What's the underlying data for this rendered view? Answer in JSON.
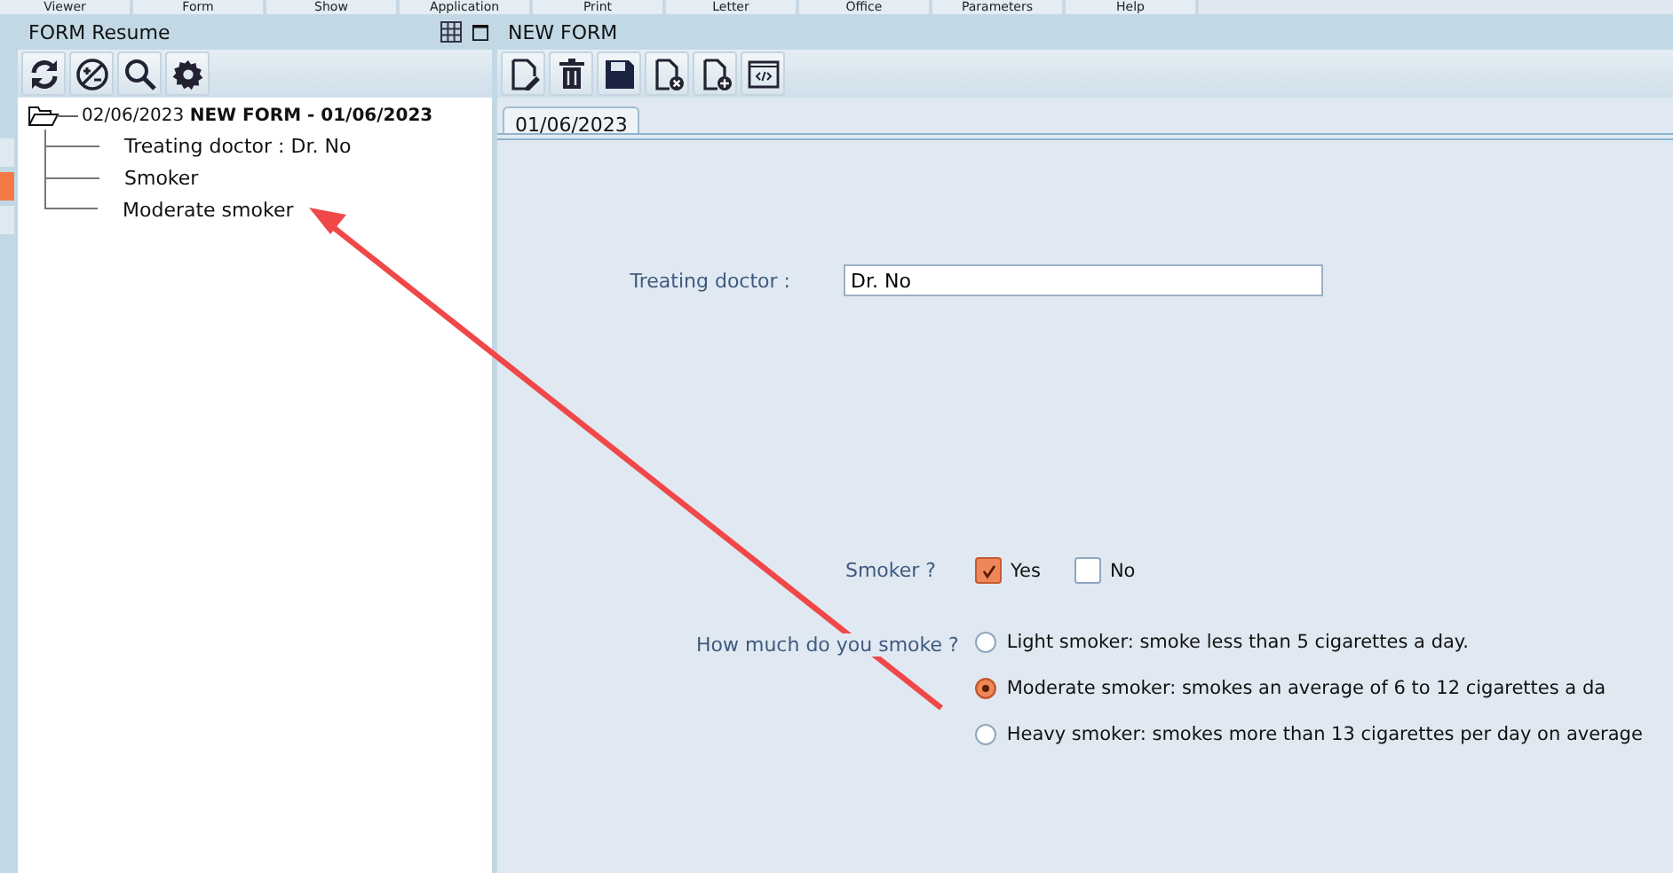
{
  "side_tabs": [
    {
      "selected": false
    },
    {
      "selected": true
    },
    {
      "selected": false
    }
  ],
  "menu": [
    "Viewer",
    "Form",
    "Show",
    "Application",
    "Print",
    "Letter",
    "Office",
    "Parameters",
    "Help"
  ],
  "left_panel": {
    "title": "FORM Resume",
    "tree": [
      {
        "date": "02/06/2023",
        "title": "NEW FORM - 01/06/2023",
        "expanded": true,
        "children": [
          {
            "label": "Treating doctor : Dr. No"
          },
          {
            "label": "Smoker"
          },
          {
            "label": "Moderate smoker"
          }
        ]
      }
    ]
  },
  "right_panel": {
    "title": "NEW FORM",
    "tabs": [
      {
        "label": "01/06/2023",
        "selected": true
      }
    ],
    "fields": [
      {
        "kind": "text",
        "label": "Treating doctor :",
        "value": "Dr. No"
      },
      {
        "kind": "checkboxes",
        "label": "Smoker ?",
        "options": [
          {
            "label": "Yes",
            "checked": true
          },
          {
            "label": "No",
            "checked": false
          }
        ]
      },
      {
        "kind": "radios",
        "label": "How much do you smoke ?",
        "options": [
          {
            "label": "Light smoker: smoke less than 5 cigarettes a day.",
            "selected": false
          },
          {
            "label": "Moderate smoker: smokes an average of 6 to 12 cigarettes a da",
            "selected": true
          },
          {
            "label": "Heavy smoker: smokes more than 13 cigarettes per day on average",
            "selected": false
          }
        ]
      }
    ]
  }
}
